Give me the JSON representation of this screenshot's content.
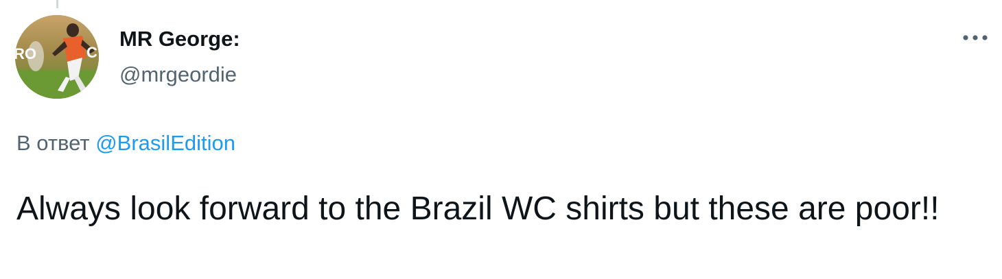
{
  "tweet": {
    "author": {
      "display_name": "MR George:",
      "handle": "@mrgeordie",
      "avatar_icon": "avatar-photo"
    },
    "more_icon": "more-horizontal-icon",
    "reply_context": {
      "prefix": "В ответ",
      "mention": "@BrasilEdition"
    },
    "text": "Always look forward to the Brazil WC shirts but these are poor!!"
  },
  "colors": {
    "text_primary": "#0f1419",
    "text_secondary": "#536471",
    "link": "#1d9bf0",
    "thread_line": "#cfd9de"
  }
}
